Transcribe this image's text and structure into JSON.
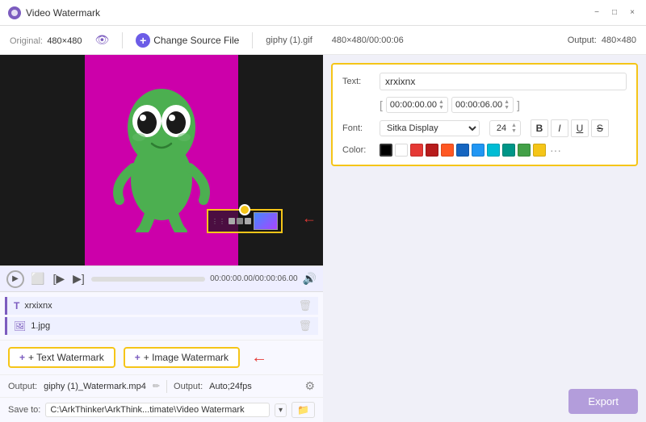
{
  "titlebar": {
    "title": "Video Watermark",
    "min_label": "−",
    "max_label": "□",
    "close_label": "×"
  },
  "toolbar": {
    "original_label": "Original:",
    "original_dim": "480×480",
    "change_source_label": "Change Source File",
    "filename": "giphy (1).gif",
    "file_info": "480×480/00:00:06",
    "output_label": "Output:",
    "output_dim": "480×480"
  },
  "video": {
    "time_current": "00:00:00.00",
    "time_total": "00:00:06.00"
  },
  "watermark_items": [
    {
      "type": "text",
      "icon": "T",
      "label": "xrxixnx"
    },
    {
      "type": "image",
      "icon": "🖼",
      "label": "1.jpg"
    }
  ],
  "add_buttons": {
    "text_label": "+ Text Watermark",
    "image_label": "+ Image Watermark"
  },
  "output_bar": {
    "label1": "Output:",
    "value1": "giphy (1)_Watermark.mp4",
    "label2": "Output:",
    "value2": "Auto;24fps"
  },
  "save_bar": {
    "label": "Save to:",
    "path": "C:\\ArkThinker\\ArkThink...timate\\Video Watermark"
  },
  "text_props": {
    "text_label": "Text:",
    "text_value": "xrxixnx",
    "time_bracket_open": "[",
    "time_start": "00:00:00.00",
    "time_end": "00:00:06.00",
    "time_bracket_close": "]",
    "font_label": "Font:",
    "font_value": "Sitka Display",
    "font_size": "24",
    "color_label": "Color:",
    "bold_label": "B",
    "italic_label": "I",
    "underline_label": "U",
    "strikethrough_label": "S",
    "export_label": "Export"
  },
  "colors": [
    {
      "name": "black",
      "hex": "#000000",
      "selected": true
    },
    {
      "name": "white",
      "hex": "#ffffff"
    },
    {
      "name": "red",
      "hex": "#e53935"
    },
    {
      "name": "dark-red",
      "hex": "#b71c1c"
    },
    {
      "name": "orange-red",
      "hex": "#ff5722"
    },
    {
      "name": "blue",
      "hex": "#1565c0"
    },
    {
      "name": "bright-blue",
      "hex": "#2196f3"
    },
    {
      "name": "cyan",
      "hex": "#00bcd4"
    },
    {
      "name": "teal",
      "hex": "#009688"
    },
    {
      "name": "green",
      "hex": "#43a047"
    },
    {
      "name": "yellow",
      "hex": "#f5c518"
    }
  ]
}
